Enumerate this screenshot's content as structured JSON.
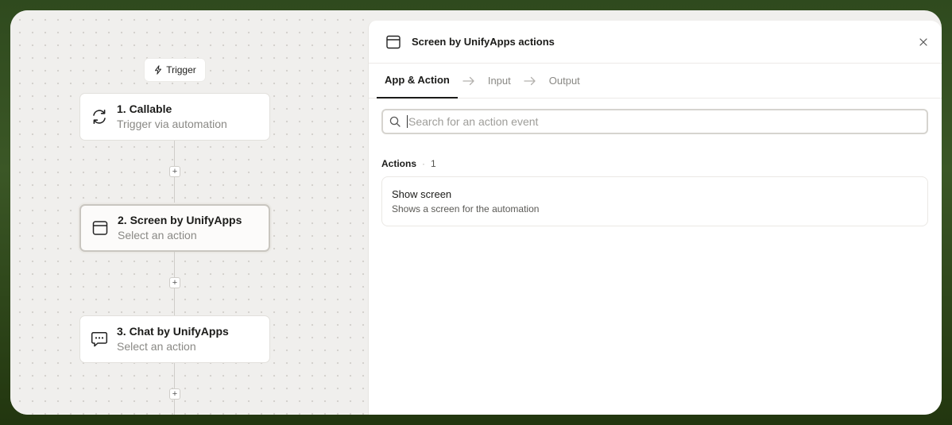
{
  "canvas": {
    "trigger_label": "Trigger",
    "nodes": [
      {
        "title": "1. Callable",
        "subtitle": "Trigger via automation",
        "icon": "refresh-icon"
      },
      {
        "title": "2. Screen by UnifyApps",
        "subtitle": "Select an action",
        "icon": "window-icon"
      },
      {
        "title": "3. Chat by UnifyApps",
        "subtitle": "Select an action",
        "icon": "chat-icon"
      }
    ],
    "add_step_symbol": "+"
  },
  "panel": {
    "title": "Screen by UnifyApps actions",
    "tabs": [
      {
        "label": "App & Action",
        "active": true
      },
      {
        "label": "Input",
        "active": false
      },
      {
        "label": "Output",
        "active": false
      }
    ],
    "search": {
      "placeholder": "Search for an action event",
      "value": ""
    },
    "actions_section": {
      "label": "Actions",
      "separator": "·",
      "count": "1",
      "items": [
        {
          "title": "Show screen",
          "description": "Shows a screen for the automation"
        }
      ]
    }
  },
  "colors": {
    "background_frame": "#33501f",
    "canvas_bg": "#f0efed",
    "text_primary": "#1b1b19",
    "text_muted": "#8a8985"
  }
}
